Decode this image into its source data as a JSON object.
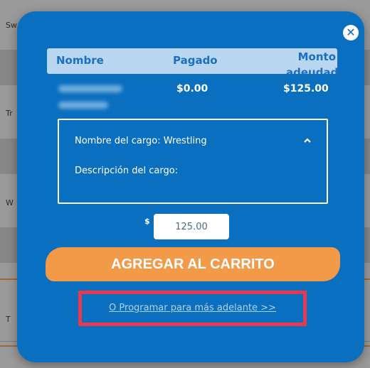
{
  "background_rows": [
    {
      "label": "Sw"
    },
    {
      "label": "Tr"
    },
    {
      "label": "W"
    },
    {
      "label": "T"
    }
  ],
  "modal": {
    "close_symbol": "✕",
    "table": {
      "headers": {
        "name": "Nombre",
        "paid": "Pagado",
        "amount_due": "Monto adeudado"
      },
      "row": {
        "paid": "$0.00",
        "amount_due": "$125.00"
      }
    },
    "charge": {
      "name_text": "Nombre del cargo: Wrestling",
      "description_text": "Descripción del cargo:",
      "toggle_icon": "chevron-up-icon"
    },
    "amount": {
      "currency_symbol": "$",
      "value": "125.00"
    },
    "add_to_cart_label": "AGREGAR AL CARRITO",
    "schedule_link_label": "O Programar para más adelante >>"
  },
  "colors": {
    "modal_bg": "#0a6fbf",
    "header_bg": "#b8d6ef",
    "cta_orange": "#f39a49",
    "highlight_red": "#e8394e"
  }
}
